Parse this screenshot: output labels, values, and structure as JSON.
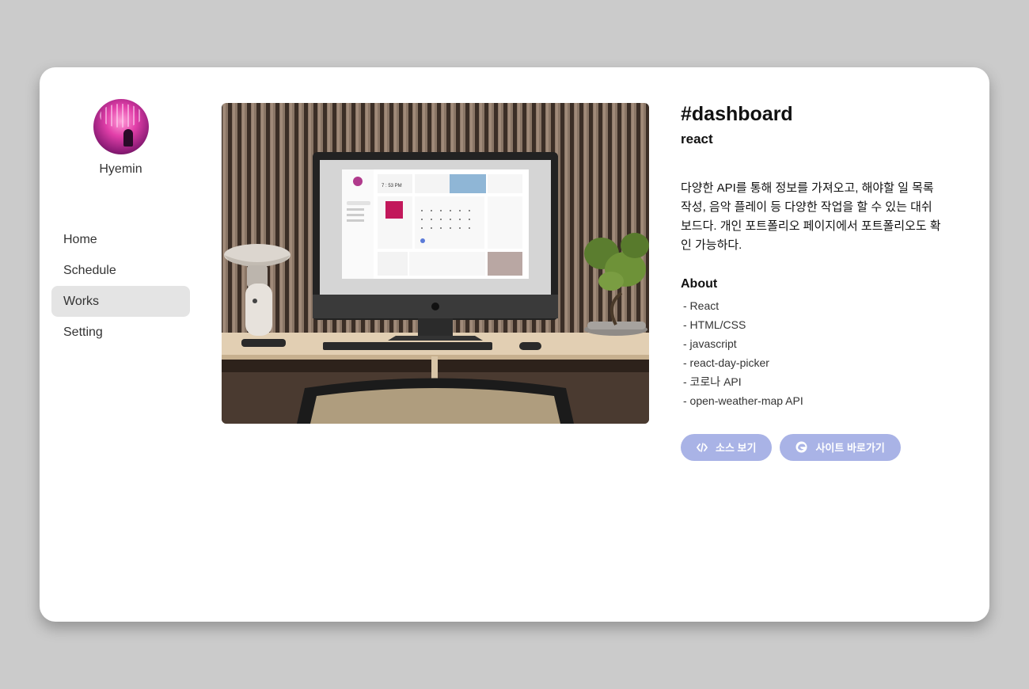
{
  "sidebar": {
    "username": "Hyemin",
    "nav": [
      {
        "label": "Home",
        "active": false
      },
      {
        "label": "Schedule",
        "active": false
      },
      {
        "label": "Works",
        "active": true
      },
      {
        "label": "Setting",
        "active": false
      }
    ]
  },
  "project": {
    "title": "#dashboard",
    "subtitle": "react",
    "description": "다양한 API를 통해 정보를 가져오고, 해야할 일 목록 작성, 음악 플레이 등 다양한 작업을 할 수 있는 대쉬보드다. 개인 포트폴리오 페이지에서 포트폴리오도 확인 가능하다.",
    "about_heading": "About",
    "about_items": [
      "- React",
      "- HTML/CSS",
      "- javascript",
      "- react-day-picker",
      "- 코로나 API",
      "- open-weather-map API"
    ],
    "mockup_clock": "7 : 53 PM",
    "buttons": {
      "source_label": "소스 보기",
      "source_icon": "code-icon",
      "site_label": "사이트 바로가기",
      "site_icon": "browser-icon"
    }
  },
  "colors": {
    "background": "#cbcbcb",
    "card": "#ffffff",
    "nav_active": "#e4e4e4",
    "button": "#a9b3e6"
  }
}
